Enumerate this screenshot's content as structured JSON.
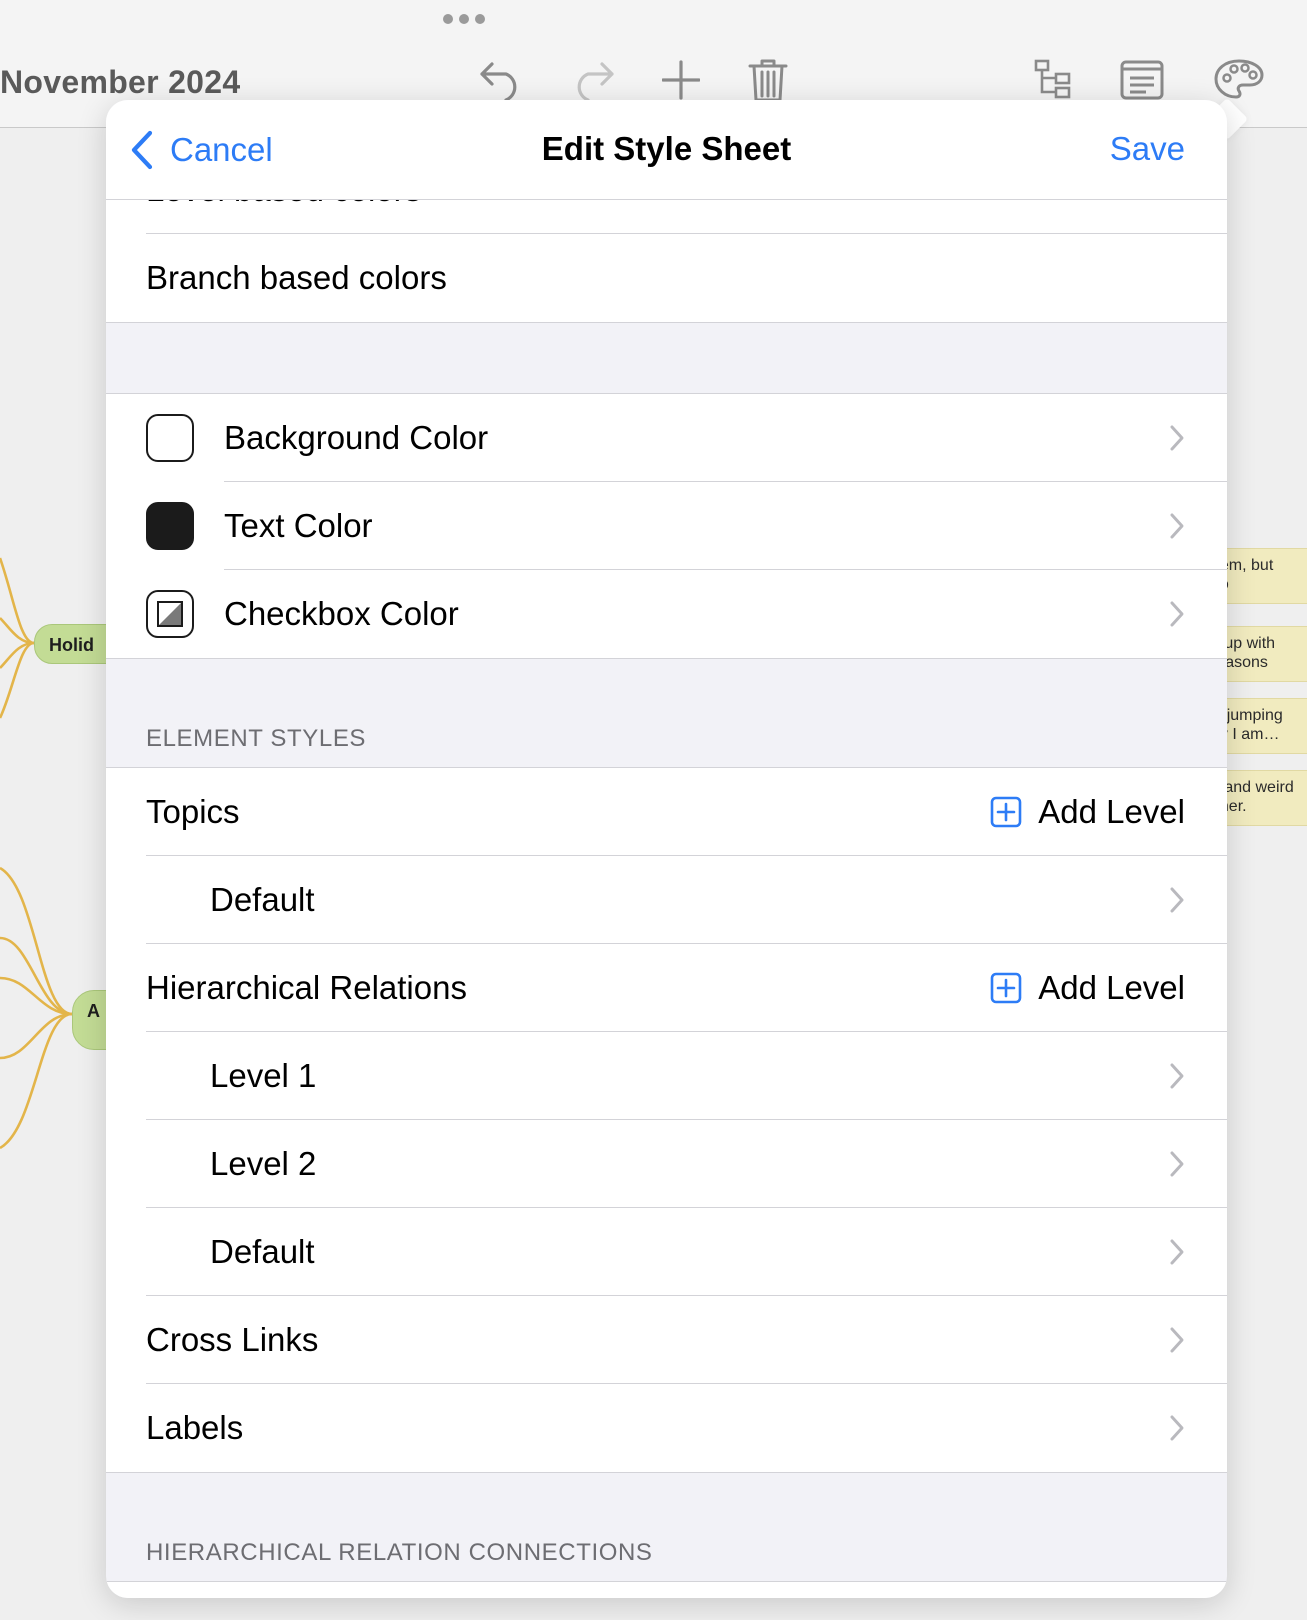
{
  "app": {
    "document_title": "November 2024"
  },
  "map": {
    "nodes": [
      "Holid",
      "A"
    ],
    "notes": [
      {
        "line1": "nem, but",
        "line2": "go"
      },
      {
        "line1": "g up with",
        "line2": "reasons"
      },
      {
        "line1": "’s jumping",
        "line2": "ay I am…"
      },
      {
        "line1": "a and weird",
        "line2": "nner."
      }
    ]
  },
  "toolbar": {
    "icons": [
      "undo-icon",
      "redo-icon",
      "add-icon",
      "trash-icon",
      "outline-icon",
      "notes-icon",
      "palette-icon"
    ]
  },
  "sheet": {
    "cancel_label": "Cancel",
    "title": "Edit Style Sheet",
    "save_label": "Save",
    "color_mode": {
      "level_based": "Level based colors",
      "branch_based": "Branch based colors",
      "selected": "Level based colors"
    },
    "colors": {
      "background": "Background Color",
      "text": "Text Color",
      "checkbox": "Checkbox Color"
    },
    "element_styles": {
      "header": "ELEMENT STYLES",
      "topics": "Topics",
      "add_level": "Add Level",
      "topics_default": "Default",
      "hierarchical_relations": "Hierarchical Relations",
      "level_1": "Level 1",
      "level_2": "Level 2",
      "relations_default": "Default",
      "cross_links": "Cross Links",
      "labels": "Labels"
    },
    "connections_header": "HIERARCHICAL RELATION CONNECTIONS"
  },
  "colors": {
    "accent": "#2d7cf6",
    "map_line": "#e3b54a",
    "node_fill": "#c3dc95",
    "note_fill": "#f1ebbf"
  }
}
